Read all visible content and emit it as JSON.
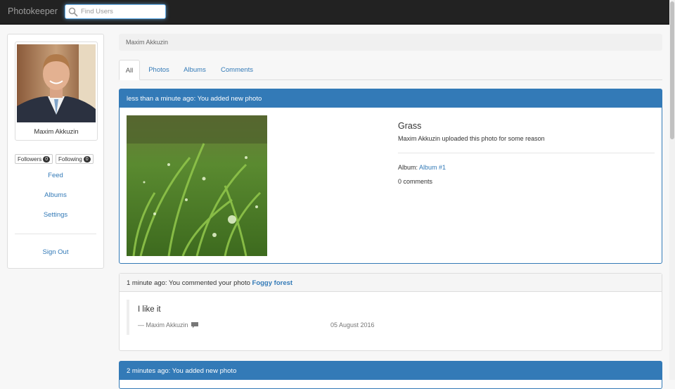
{
  "navbar": {
    "brand": "Photokeeper",
    "search_placeholder": "Find Users"
  },
  "sidebar": {
    "profile_name": "Maxim Akkuzin",
    "followers_label": "Followers",
    "followers_count": "0",
    "following_label": "Following",
    "following_count": "0",
    "links": [
      "Feed",
      "Albums",
      "Settings"
    ],
    "sign_out": "Sign Out"
  },
  "breadcrumb": "Maxim Akkuzin",
  "tabs": [
    "All",
    "Photos",
    "Albums",
    "Comments"
  ],
  "feed": [
    {
      "heading": "less than a minute ago: You added new photo",
      "photo_title": "Grass",
      "photo_description": "Maxim Akkuzin uploaded this photo for some reason",
      "album_label": "Album:",
      "album_link": "Album #1",
      "comments": "0 comments"
    },
    {
      "heading_prefix": "1 minute ago: You commented your photo",
      "heading_link": "Foggy forest",
      "comment_text": "I like it",
      "comment_author": "— Maxim Akkuzin",
      "comment_date": "05 August 2016"
    },
    {
      "heading": "2 minutes ago: You added new photo"
    }
  ],
  "colors": {
    "primary": "#337ab7",
    "navbar": "#222222"
  }
}
